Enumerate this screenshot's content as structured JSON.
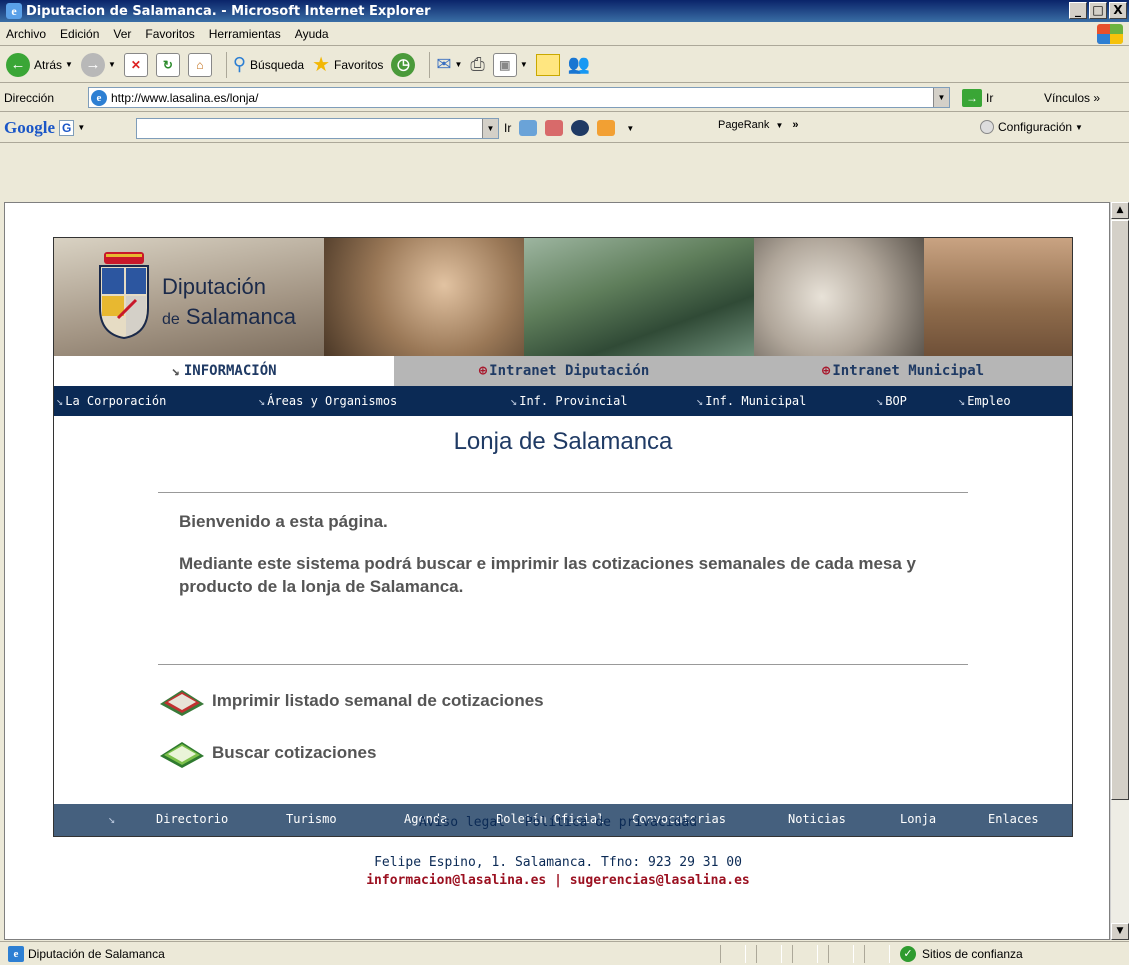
{
  "window": {
    "title": "Diputacion de Salamanca. - Microsoft Internet Explorer",
    "minimize": "_",
    "maximize": "□",
    "close": "X"
  },
  "menu": [
    "Archivo",
    "Edición",
    "Ver",
    "Favoritos",
    "Herramientas",
    "Ayuda"
  ],
  "toolbar": {
    "back": "Atrás",
    "search": "Búsqueda",
    "favorites": "Favoritos"
  },
  "address": {
    "label": "Dirección",
    "url": "http://www.lasalina.es/lonja/",
    "go": "Ir",
    "links": "Vínculos »"
  },
  "google": {
    "logo": "Google",
    "g": "G",
    "go": "Ir",
    "pagerank": "PageRank",
    "more": "»",
    "config": "Configuración"
  },
  "banner": {
    "logo_line1": "Diputación",
    "logo_de": "de",
    "logo_line2": "Salamanca"
  },
  "tabs": [
    {
      "label": "INFORMACIÓN"
    },
    {
      "label": "Intranet Diputación"
    },
    {
      "label": "Intranet Municipal"
    }
  ],
  "nav": [
    {
      "label": "La Corporación"
    },
    {
      "label": "Áreas y Organismos"
    },
    {
      "label": "Inf. Provincial"
    },
    {
      "label": "Inf. Municipal"
    },
    {
      "label": "BOP"
    },
    {
      "label": "Empleo"
    }
  ],
  "page": {
    "title": "Lonja de Salamanca",
    "welcome": "Bienvenido a esta página.",
    "description": "Mediante este sistema podrá buscar e imprimir las cotizaciones semanales de cada mesa y producto de la lonja de Salamanca.",
    "action_print": "Imprimir listado semanal de cotizaciones",
    "action_search": "Buscar cotizaciones"
  },
  "bottom_nav": [
    {
      "label": "Directorio"
    },
    {
      "label": "Turismo"
    },
    {
      "label": "Agenda"
    },
    {
      "label": "Boletín Oficial"
    },
    {
      "label": "Convocatorias"
    },
    {
      "label": "Noticias"
    },
    {
      "label": "Lonja"
    },
    {
      "label": "Enlaces"
    }
  ],
  "footer": {
    "legal": "Aviso legal",
    "privacy": "Política de privacidad",
    "address": "Felipe Espino, 1. Salamanca. Tfno: 923 29 31 00",
    "email_info": "informacion@lasalina.es",
    "separator": "|",
    "email_suggest": "sugerencias@lasalina.es"
  },
  "status": {
    "text": "Diputación de Salamanca",
    "zone": "Sitios de confianza"
  },
  "colors": {
    "navy": "#0b2a55",
    "bottom_nav": "#45607e",
    "footer_email": "#9b1020",
    "heading": "#1f3a64"
  }
}
